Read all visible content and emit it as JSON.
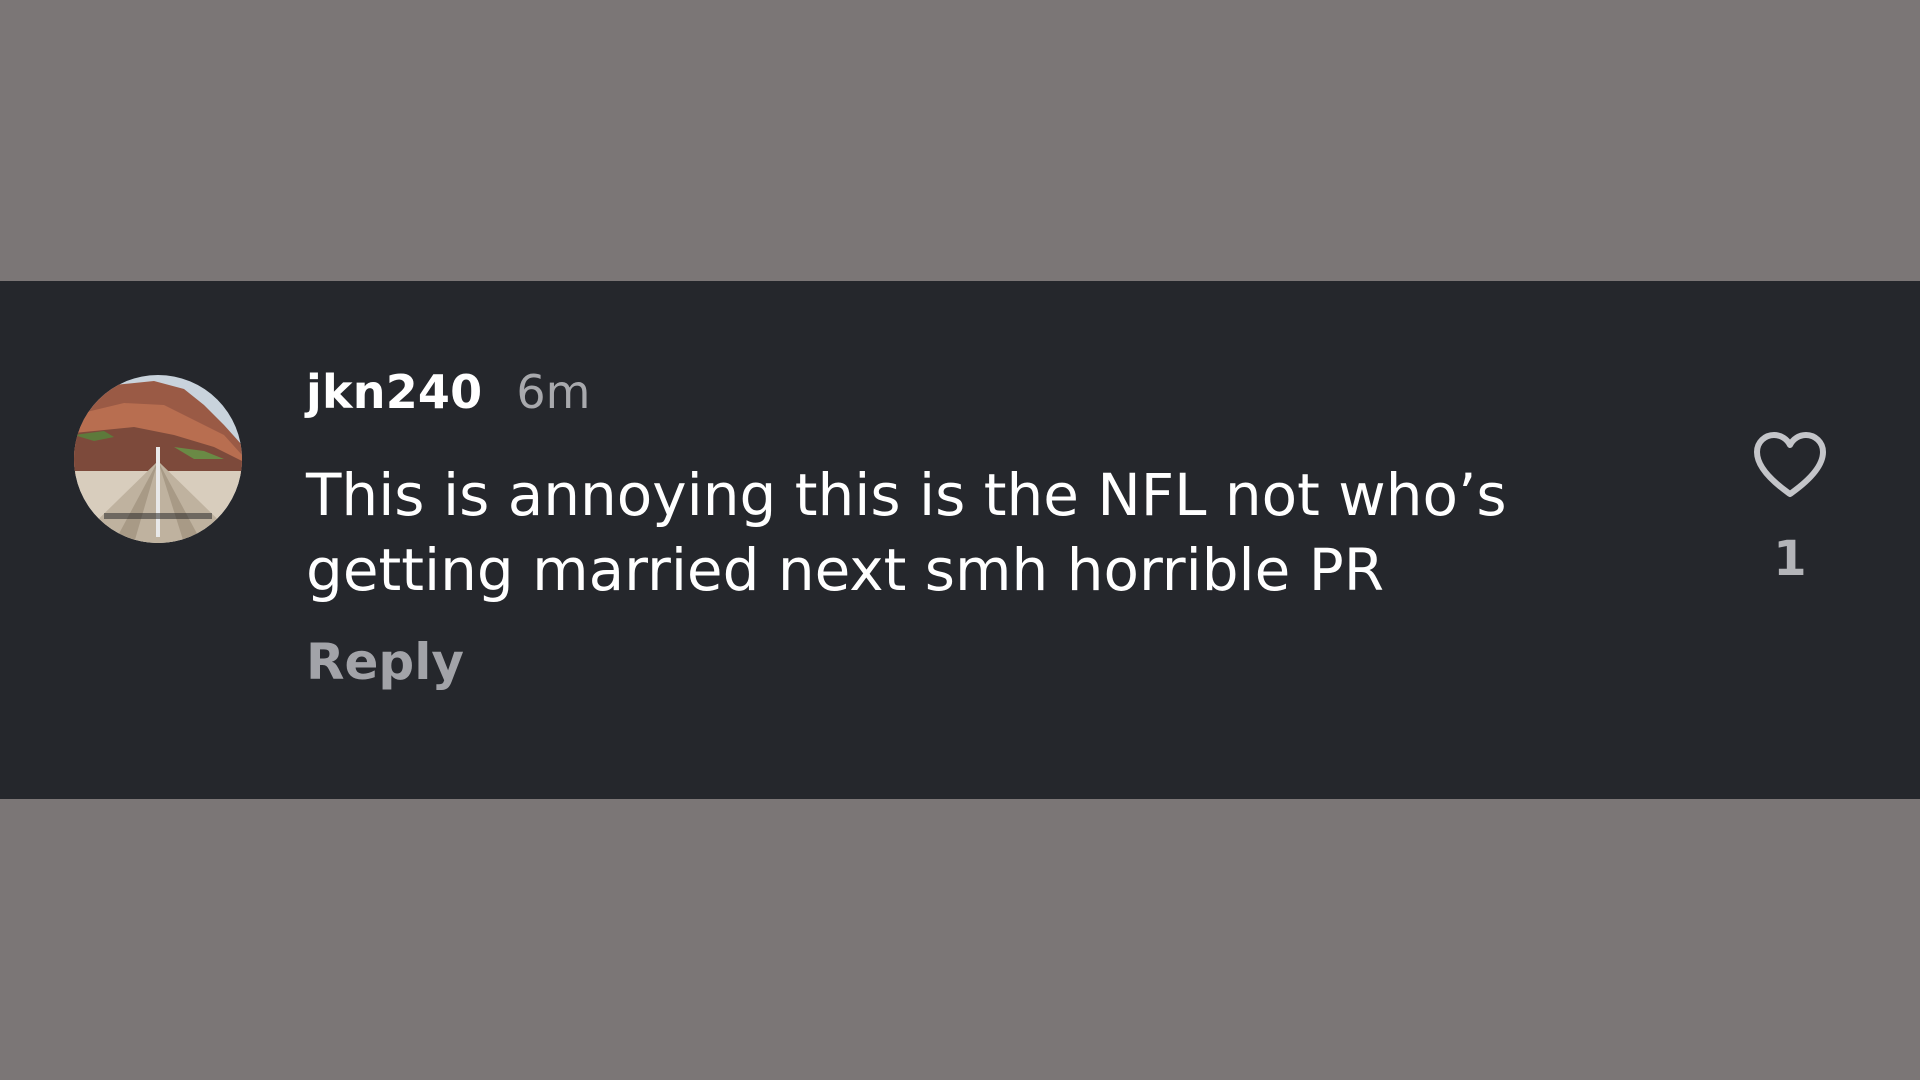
{
  "comment": {
    "username": "jkn240",
    "timestamp": "6m",
    "text": "This is annoying this is the NFL not who’s\ngetting married next smh horrible PR",
    "reply_label": "Reply",
    "like_count": "1",
    "like_icon": "heart-outline-icon"
  },
  "colors": {
    "page_background": "#7b7676",
    "card_background": "#25272c",
    "primary_text": "#ffffff",
    "secondary_text": "#a2a3a8"
  }
}
